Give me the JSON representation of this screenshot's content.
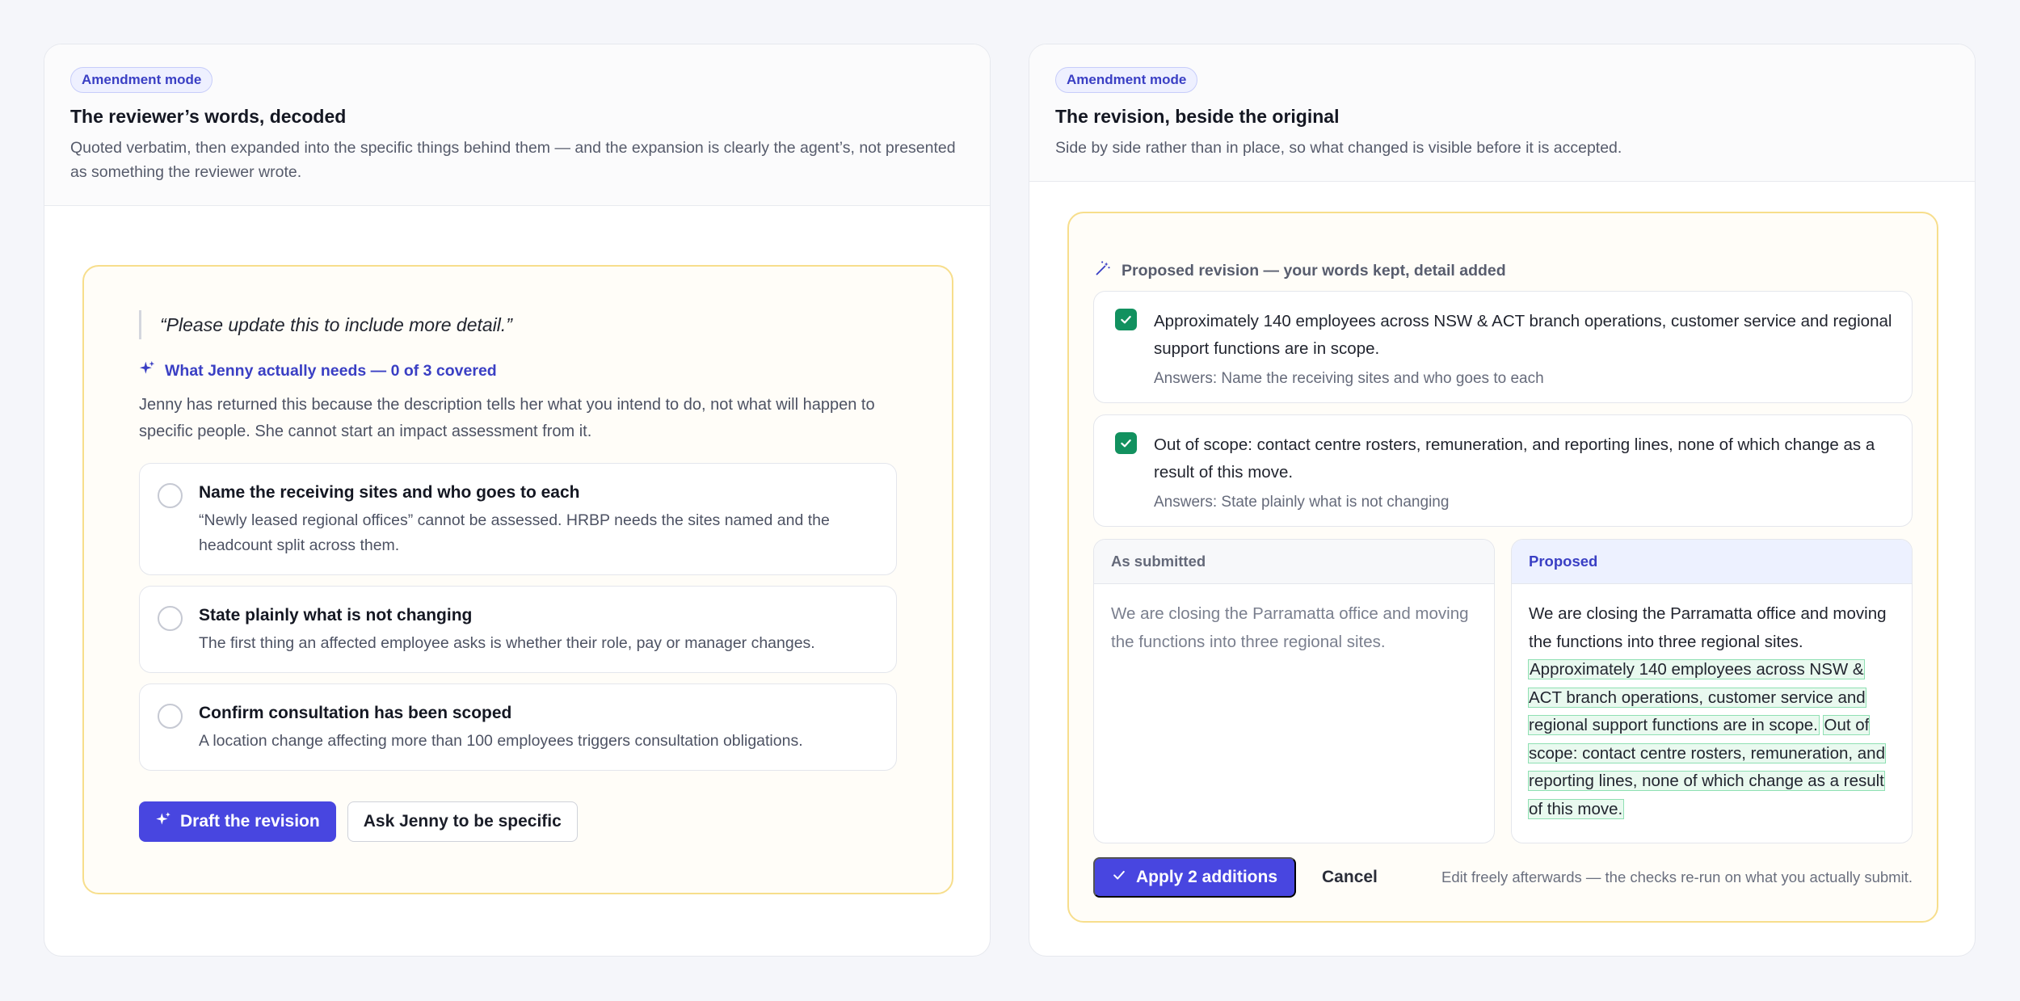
{
  "left_panel": {
    "mode_label": "Amendment mode",
    "title": "The reviewer’s words, decoded",
    "subtitle": "Quoted verbatim, then expanded into the specific things behind them — and the expansion is clearly the agent’s, not presented as something the reviewer wrote.",
    "quote": "“Please update this to include more detail.”",
    "needs_heading": "What Jenny actually needs — 0 of 3 covered",
    "needs_description": "Jenny has returned this because the description tells her what you intend to do, not what will happen to specific people. She cannot start an impact assessment from it.",
    "needs": [
      {
        "title": "Name the receiving sites and who goes to each",
        "text": "“Newly leased regional offices” cannot be assessed. HRBP needs the sites named and the headcount split across them.",
        "checked": false
      },
      {
        "title": "State plainly what is not changing",
        "text": "The first thing an affected employee asks is whether their role, pay or manager changes.",
        "checked": false
      },
      {
        "title": "Confirm consultation has been scoped",
        "text": "A location change affecting more than 100 employees triggers consultation obligations.",
        "checked": false
      }
    ],
    "primary_button": "Draft the revision",
    "secondary_button": "Ask Jenny to be specific"
  },
  "right_panel": {
    "mode_label": "Amendment mode",
    "title": "The revision, beside the original",
    "subtitle": "Side by side rather than in place, so what changed is visible before it is accepted.",
    "revision_heading": "Proposed revision — your words kept, detail added",
    "additions": [
      {
        "text": "Approximately 140 employees across NSW & ACT branch operations, customer service and regional support functions are in scope.",
        "answer": "Answers: Name the receiving sites and who goes to each",
        "checked": true
      },
      {
        "text": "Out of scope: contact centre rosters, remuneration, and reporting lines, none of which change as a result of this move.",
        "answer": "Answers: State plainly what is not changing",
        "checked": true
      }
    ],
    "as_submitted": {
      "label": "As submitted",
      "text": "We are closing the Parramatta office and moving the functions into three regional sites."
    },
    "proposed": {
      "label": "Proposed",
      "base_text": "We are closing the Parramatta office and moving the functions into three regional sites.",
      "added_1": "Approximately 140 employees across NSW & ACT branch operations, customer service and regional support functions are in scope.",
      "added_2": "Out of scope: contact centre rosters, remuneration, and reporting lines, none of which change as a result of this move."
    },
    "apply_button": "Apply 2 additions",
    "cancel_button": "Cancel",
    "note": "Edit freely afterwards — the checks re-run on what you actually submit."
  },
  "colors": {
    "accent": "#4846e0",
    "accent_text": "#3a3fc4",
    "check_green": "#12915f",
    "card_border": "#f7de8c",
    "highlight_bg": "#e9f9ef",
    "highlight_border": "#8fe0b3"
  },
  "icons": {
    "sparkle": "sparkle-icon",
    "magic_wand": "magic-wand-icon",
    "check": "check-icon",
    "radio": "radio-unchecked-icon",
    "checkbox": "checkbox-checked-icon"
  }
}
